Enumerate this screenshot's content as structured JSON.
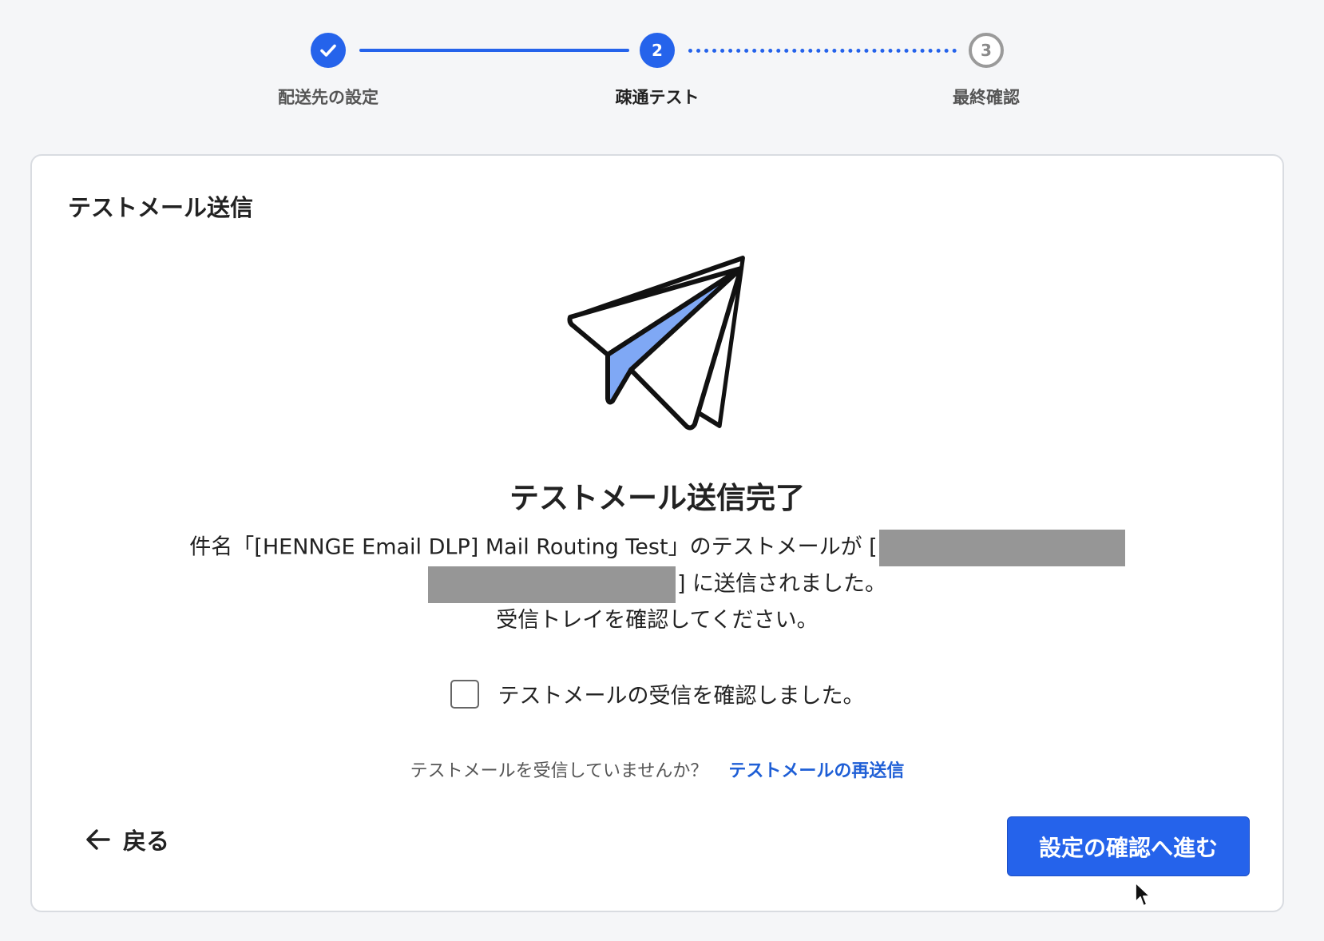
{
  "stepper": {
    "steps": [
      {
        "label": "配送先の設定",
        "state": "done"
      },
      {
        "label": "疎通テスト",
        "state": "active",
        "number": "2"
      },
      {
        "label": "最終確認",
        "state": "pending",
        "number": "3"
      }
    ]
  },
  "card": {
    "title": "テストメール送信",
    "complete_title": "テストメール送信完了",
    "message": {
      "line1_prefix": "件名「[HENNGE Email DLP] Mail Routing Test」のテストメールが [",
      "line2_suffix": "] に送信されました。",
      "line3": "受信トレイを確認してください。"
    },
    "confirm_checkbox": {
      "label": "テストメールの受信を確認しました。",
      "checked": false
    },
    "resend": {
      "question": "テストメールを受信していませんか？",
      "link_label": "テストメールの再送信"
    },
    "back_label": "戻る",
    "next_label": "設定の確認へ進む"
  },
  "colors": {
    "accent": "#2563eb",
    "link": "#1f5fd6",
    "redaction": "#969696",
    "plane_fill": "#7fa8f5"
  },
  "icons": {
    "step1": "check-icon",
    "plane": "paper-plane-icon",
    "back": "arrow-left-icon",
    "cursor": "mouse-pointer-icon"
  }
}
